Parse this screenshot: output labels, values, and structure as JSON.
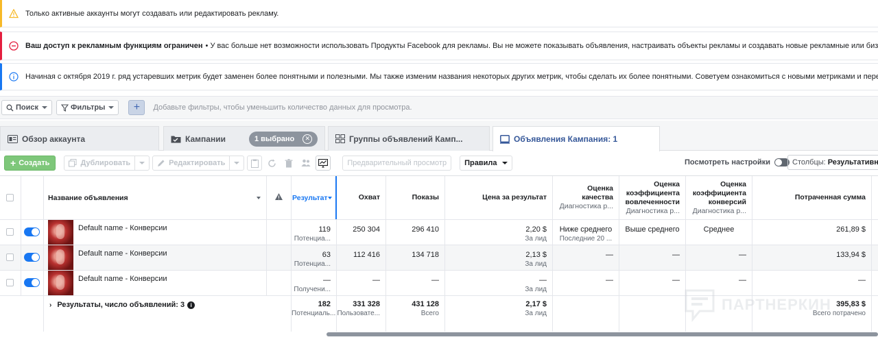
{
  "banners": {
    "warning_text": "Только активные аккаунты могут создавать или редактировать рекламу.",
    "restricted_title": "Ваш доступ к рекламным функциям ограничен",
    "restricted_text": "• У вас больше нет возможности использовать Продукты Facebook для рекламы. Вы не можете показывать объявления, настраивать объекты рекламы и создавать новые рекламные или бизнес-аккаунты.",
    "info_text": "Начиная с октября 2019 г. ряд устаревших метрик будет заменен более понятными и полезными. Мы также изменим названия некоторых других метрик, чтобы сделать их более понятными. Советуем ознакомиться с новыми метриками и перейти на них как м"
  },
  "filters": {
    "search_label": "Поиск",
    "filters_label": "Фильтры",
    "placeholder": "Добавьте фильтры, чтобы уменьшить количество данных для просмотра."
  },
  "tabs": {
    "overview": "Обзор аккаунта",
    "campaigns": "Кампании",
    "selected_pill": "1 выбрано",
    "adsets": "Группы объявлений Камп...",
    "ads": "Объявления Кампания: 1"
  },
  "toolbar": {
    "create": "Создать",
    "duplicate": "Дублировать",
    "edit": "Редактировать",
    "preview": "Предварительный просмотр",
    "rules": "Правила",
    "view_settings": "Посмотреть настройки",
    "columns_label": "Столбцы:",
    "columns_value": "Результативно"
  },
  "table": {
    "headers": {
      "name": "Название объявления",
      "results": "Результат",
      "reach": "Охват",
      "impressions": "Показы",
      "cost": "Цена за результат",
      "quality": "Оценка качества",
      "quality_sub": "Диагностика р...",
      "engagement": "Оценка коэффициента вовлеченности",
      "engagement_sub": "Диагностика р...",
      "conversion": "Оценка коэффициента конверсий",
      "conversion_sub": "Диагностика р...",
      "spent": "Потраченная сумма"
    },
    "rows": [
      {
        "name": "Default name - Конверсии",
        "results": "119",
        "results_sub": "Потенциа...",
        "reach": "250 304",
        "impressions": "296 410",
        "cost": "2,20 $",
        "cost_sub": "За лид",
        "quality": "Ниже среднего",
        "quality_sub": "Последние 20 ...",
        "engagement": "Выше среднего",
        "conversion": "Среднее",
        "spent": "261,89 $"
      },
      {
        "name": "Default name - Конверсии",
        "results": "63",
        "results_sub": "Потенциа...",
        "reach": "112 416",
        "impressions": "134 718",
        "cost": "2,13 $",
        "cost_sub": "За лид",
        "quality": "—",
        "quality_sub": "",
        "engagement": "—",
        "conversion": "—",
        "spent": "133,94 $"
      },
      {
        "name": "Default name - Конверсии",
        "results": "—",
        "results_sub": "Получени...",
        "reach": "—",
        "impressions": "—",
        "cost": "—",
        "cost_sub": "За лид",
        "quality": "—",
        "quality_sub": "",
        "engagement": "—",
        "conversion": "—",
        "spent": "—"
      }
    ],
    "total": {
      "label": "Результаты, число объявлений: 3",
      "results": "182",
      "results_sub": "Потенциаль...",
      "reach": "331 328",
      "reach_sub": "Пользовате...",
      "impressions": "431 128",
      "impressions_sub": "Всего",
      "cost": "2,17 $",
      "cost_sub": "За лид",
      "spent": "395,83 $",
      "spent_sub": "Всего потрачено"
    }
  },
  "watermark": "ПАРТНЕРКИН",
  "colors": {
    "accent": "#1877f2",
    "create": "#7ec77a",
    "warning": "#f7b928",
    "error": "#e41e3f"
  }
}
